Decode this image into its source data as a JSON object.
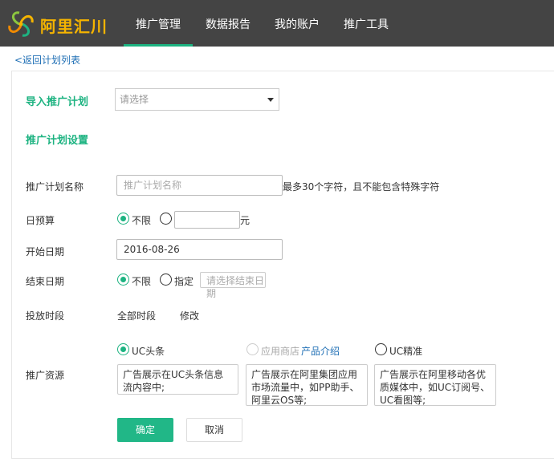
{
  "brand": {
    "logo_text": "阿里汇川",
    "primary_color": "#1db381",
    "logo_color": "#f5b400",
    "topbar_color": "#444444"
  },
  "nav": {
    "items": [
      {
        "label": "推广管理",
        "active": true
      },
      {
        "label": "数据报告",
        "active": false
      },
      {
        "label": "我的账户",
        "active": false
      },
      {
        "label": "推广工具",
        "active": false
      }
    ]
  },
  "back_link": "<返回计划列表",
  "import": {
    "label": "导入推广计划",
    "placeholder": "请选择"
  },
  "settings_title": "推广计划设置",
  "form": {
    "name": {
      "label": "推广计划名称",
      "placeholder": "推广计划名称",
      "hint": "最多30个字符，且不能包含特殊字符"
    },
    "budget": {
      "label": "日预算",
      "option_unlimited": "不限",
      "unit": "元",
      "selected": "不限"
    },
    "start_date": {
      "label": "开始日期",
      "value": "2016-08-26"
    },
    "end_date": {
      "label": "结束日期",
      "option_unlimited": "不限",
      "option_specify": "指定",
      "placeholder": "请选择结束日期",
      "selected": "不限"
    },
    "time_slot": {
      "label": "投放时段",
      "value": "全部时段",
      "modify": "修改"
    },
    "resources": {
      "label": "推广资源",
      "options": [
        {
          "label": "UC头条",
          "selected": true,
          "disabled": false,
          "desc": "广告展示在UC头条信息流内容中;"
        },
        {
          "label": "应用商店",
          "selected": false,
          "disabled": true,
          "link": "产品介绍",
          "desc": "广告展示在阿里集团应用市场流量中，如PP助手、阿里云OS等;"
        },
        {
          "label": "UC精准",
          "selected": false,
          "disabled": false,
          "desc": "广告展示在阿里移动各优质媒体中，如UC订阅号、UC看图等;"
        }
      ]
    }
  },
  "buttons": {
    "confirm": "确定",
    "cancel": "取消"
  }
}
